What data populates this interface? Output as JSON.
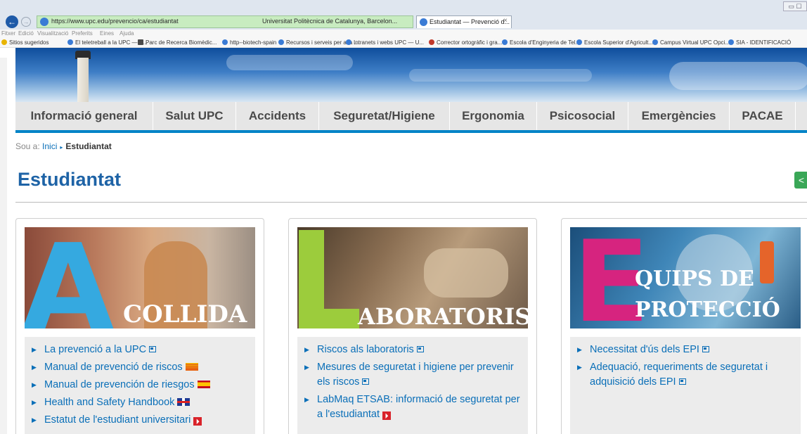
{
  "browser": {
    "url": "https://www.upc.edu/prevencio/ca/estudiantat",
    "site_identity": "Universitat Politècnica de Catalunya, Barcelon...",
    "tab_title": "Estudiantat — Prevenció d...",
    "menu": [
      "Fitxer",
      "Edició",
      "Visualització",
      "Preferits",
      "Eines",
      "Ajuda"
    ],
    "favorites": [
      "Sitios sugeridos",
      "El teletreball a la UPC — S...",
      "Parc de Recerca Biomèdic...",
      "http--biotech-spain",
      "Recursos i serveis per a la ...",
      "Intranets i webs UPC — U...",
      "Corrector ortogràfic i gra...",
      "Escola d'Enginyeria de Tel...",
      "Escola Superior d'Agricult...",
      "Campus Virtual UPC Opci...",
      "SIA - IDENTIFICACIÓ"
    ]
  },
  "nav": {
    "items": [
      "Informació general",
      "Salut UPC",
      "Accidents",
      "Seguretat/Higiene",
      "Ergonomia",
      "Psicosocial",
      "Emergències",
      "PACAE"
    ]
  },
  "breadcrumb": {
    "prefix": "Sou a:",
    "home": "Inici",
    "current": "Estudiantat"
  },
  "page": {
    "title": "Estudiantat"
  },
  "colors": {
    "accent_blue": "#0083c7",
    "title_blue": "#1e63a6",
    "share_green": "#3aa757"
  },
  "cards": [
    {
      "big_letter": "A",
      "word": "COLLIDA",
      "letter_color": "#35a9e0",
      "links": [
        {
          "text": "La prevenció a la UPC",
          "icon": "external-link-icon"
        },
        {
          "text": "Manual de prevenció de riscos",
          "icon": "catalan-flag-icon"
        },
        {
          "text": "Manual de prevención de riesgos",
          "icon": "spanish-flag-icon"
        },
        {
          "text": "Health and Safety Handbook",
          "icon": "uk-flag-icon"
        },
        {
          "text": "Estatut de l'estudiant universitari",
          "icon": "pdf-icon"
        }
      ]
    },
    {
      "big_letter": "L",
      "word": "ABORATORIS",
      "letter_color": "#9ccc3c",
      "links": [
        {
          "text": "Riscos als laboratoris",
          "icon": "external-link-icon"
        },
        {
          "text": "Mesures de seguretat i higiene per prevenir els riscos",
          "icon": "external-link-icon"
        },
        {
          "text": "LabMaq ETSAB: informació de seguretat per a l'estudiantat",
          "icon": "pdf-icon"
        }
      ]
    },
    {
      "big_letter": "E",
      "word_line1": "QUIPS DE",
      "word_line2": "PROTECCIÓ",
      "letter_color": "#d6247f",
      "links": [
        {
          "text": "Necessitat d'ús dels EPI",
          "icon": "external-link-icon"
        },
        {
          "text": "Adequació, requeriments de seguretat i adquisició dels EPI",
          "icon": "external-link-icon"
        }
      ]
    }
  ]
}
